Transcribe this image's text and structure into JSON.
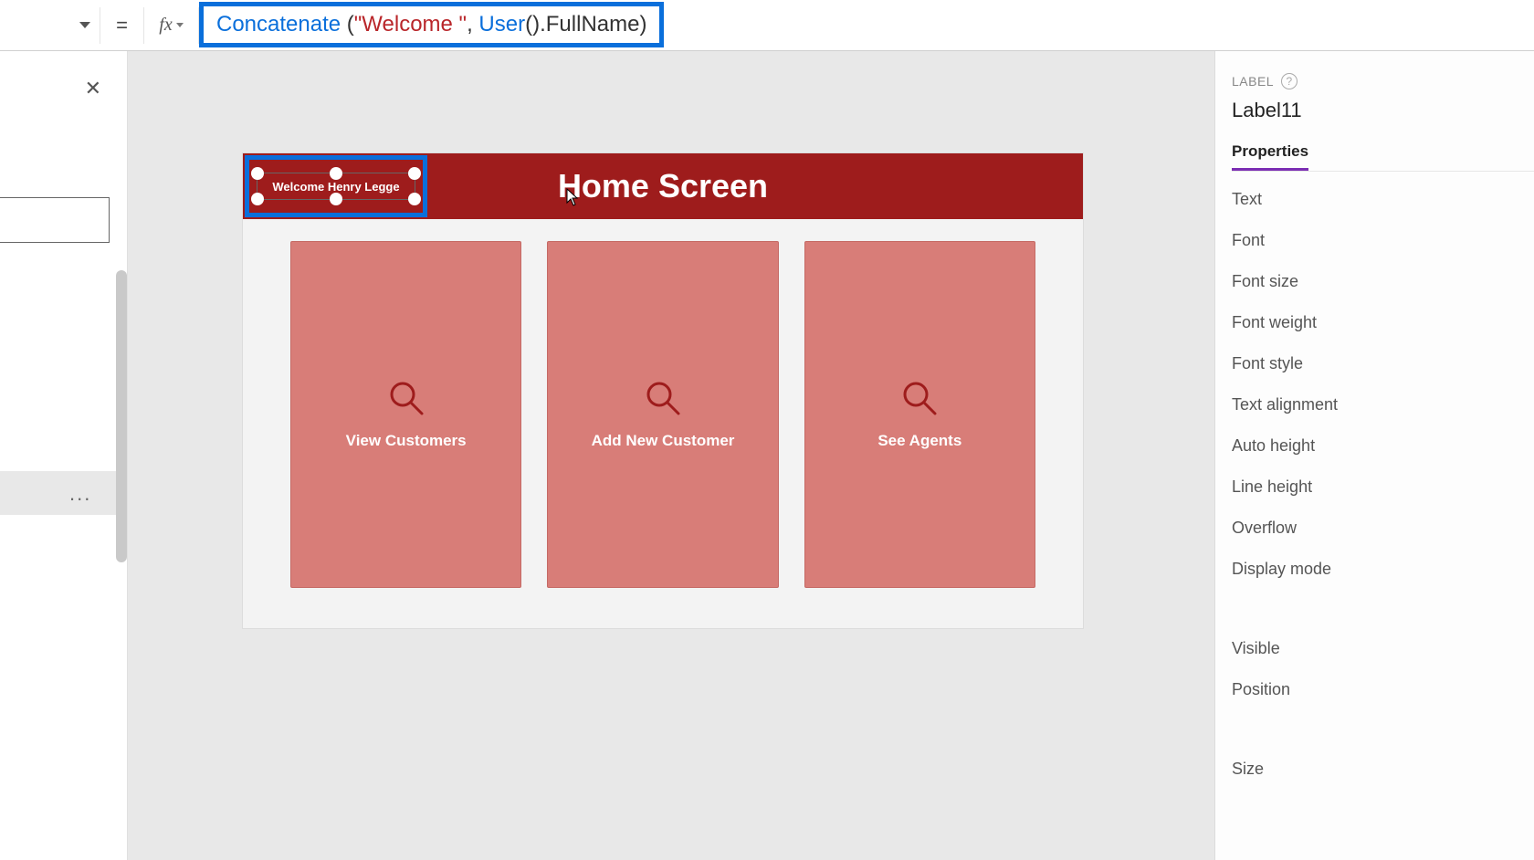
{
  "formula_bar": {
    "equals": "=",
    "fx": "fx",
    "tokens": {
      "concat": "Concatenate ",
      "lp1": "(",
      "str": "\"Welcome \"",
      "comma": ", ",
      "user": "User",
      "lp2": "(",
      "rp2": ")",
      "dot": ".",
      "prop": "FullName",
      "rp1": ")"
    }
  },
  "left_panel": {
    "ellipsis": "..."
  },
  "canvas": {
    "header_title": "Home Screen",
    "selected_label_text": "Welcome Henry Legge",
    "cards": [
      {
        "label": "View Customers"
      },
      {
        "label": "Add New Customer"
      },
      {
        "label": "See Agents"
      }
    ]
  },
  "props": {
    "section": "LABEL",
    "control_name": "Label11",
    "tab": "Properties",
    "items": [
      "Text",
      "Font",
      "Font size",
      "Font weight",
      "Font style",
      "Text alignment",
      "Auto height",
      "Line height",
      "Overflow",
      "Display mode"
    ],
    "items2": [
      "Visible",
      "Position"
    ],
    "items3": [
      "Size"
    ]
  }
}
